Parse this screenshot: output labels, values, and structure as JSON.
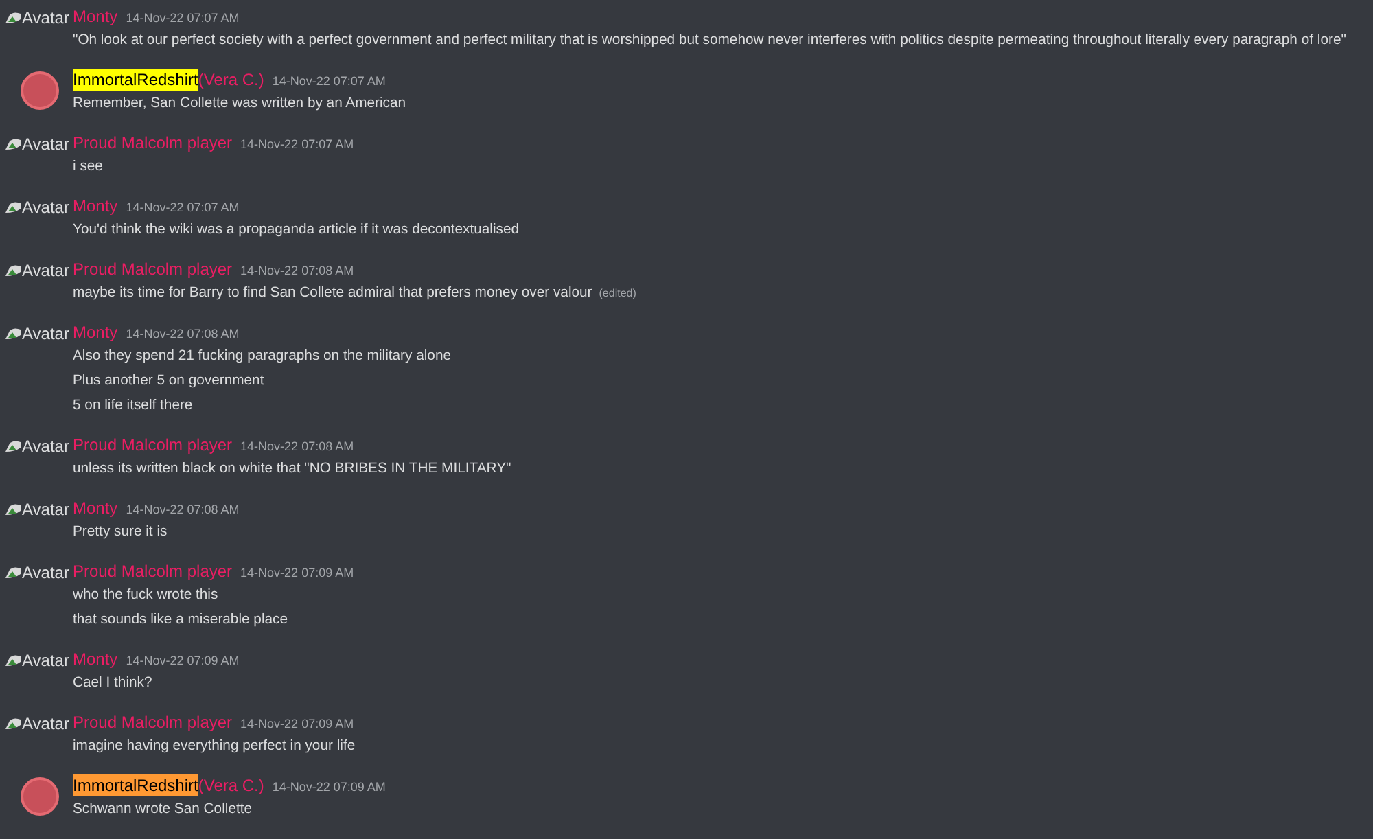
{
  "messages": [
    {
      "avatar": {
        "kind": "broken",
        "alt": "Avatar"
      },
      "author": "Monty",
      "timestamp": "14-Nov-22 07:07 AM",
      "lines": [
        "\"Oh look at our perfect society with a perfect government and perfect military that is worshipped but somehow never interferes with politics despite permeating throughout literally every paragraph of lore\""
      ]
    },
    {
      "avatar": {
        "kind": "image"
      },
      "author": "ImmortalRedshirt",
      "color": "#ffff00",
      "nickname": "(Vera C.)",
      "timestamp": "14-Nov-22 07:07 AM",
      "lines": [
        "Remember, San Collette was written by an American"
      ]
    },
    {
      "avatar": {
        "kind": "broken",
        "alt": "Avatar"
      },
      "author": "Proud Malcolm player",
      "timestamp": "14-Nov-22 07:07 AM",
      "lines": [
        "i see"
      ]
    },
    {
      "avatar": {
        "kind": "broken",
        "alt": "Avatar"
      },
      "author": "Monty",
      "timestamp": "14-Nov-22 07:07 AM",
      "lines": [
        "You'd think the wiki was a propaganda article if it was decontextualised"
      ]
    },
    {
      "avatar": {
        "kind": "broken",
        "alt": "Avatar"
      },
      "author": "Proud Malcolm player",
      "timestamp": "14-Nov-22 07:08 AM",
      "lines": [
        "maybe its time for Barry to find San Collete admiral that prefers money over valour"
      ],
      "edited": "(edited)"
    },
    {
      "avatar": {
        "kind": "broken",
        "alt": "Avatar"
      },
      "author": "Monty",
      "timestamp": "14-Nov-22 07:08 AM",
      "lines": [
        "Also they spend 21 fucking paragraphs on the military alone",
        "Plus another 5 on government",
        "5 on life itself there"
      ]
    },
    {
      "avatar": {
        "kind": "broken",
        "alt": "Avatar"
      },
      "author": "Proud Malcolm player",
      "timestamp": "14-Nov-22 07:08 AM",
      "lines": [
        "unless its written black on white that \"NO BRIBES IN THE MILITARY\""
      ]
    },
    {
      "avatar": {
        "kind": "broken",
        "alt": "Avatar"
      },
      "author": "Monty",
      "timestamp": "14-Nov-22 07:08 AM",
      "lines": [
        "Pretty sure it is"
      ]
    },
    {
      "avatar": {
        "kind": "broken",
        "alt": "Avatar"
      },
      "author": "Proud Malcolm player",
      "timestamp": "14-Nov-22 07:09 AM",
      "lines": [
        "who the fuck wrote this",
        "that sounds like a miserable place"
      ]
    },
    {
      "avatar": {
        "kind": "broken",
        "alt": "Avatar"
      },
      "author": "Monty",
      "timestamp": "14-Nov-22 07:09 AM",
      "lines": [
        "Cael I think?"
      ]
    },
    {
      "avatar": {
        "kind": "broken",
        "alt": "Avatar"
      },
      "author": "Proud Malcolm player",
      "timestamp": "14-Nov-22 07:09 AM",
      "lines": [
        "imagine having everything perfect in your life"
      ]
    },
    {
      "avatar": {
        "kind": "image"
      },
      "author": "ImmortalRedshirt",
      "color": "#ff9933",
      "nickname": "(Vera C.)",
      "timestamp": "14-Nov-22 07:09 AM",
      "lines": [
        "Schwann wrote San Collette"
      ]
    }
  ]
}
